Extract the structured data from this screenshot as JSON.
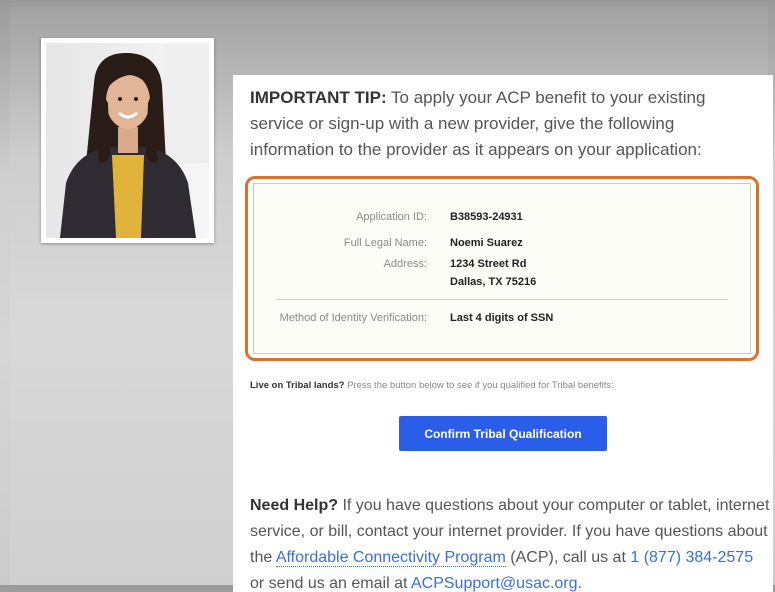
{
  "tip": {
    "heading": "IMPORTANT TIP:",
    "text": " To apply your ACP benefit to your existing service or sign-up with a new provider, give the following information to the provider as it appears on your application:"
  },
  "details": {
    "application_id_label": "Application ID:",
    "application_id_value": "B38593-24931",
    "name_label": "Full Legal Name:",
    "name_value": "Noemi Suarez",
    "address_label": "Address:",
    "address_line1": "1234 Street Rd",
    "address_line2": "Dallas, TX 75216",
    "method_label": "Method of Identity Verification:",
    "method_value": "Last 4 digits of SSN"
  },
  "tribal": {
    "question": "Live on Tribal lands?",
    "text": " Press the button below to see if you qualified for Tribal benefits:",
    "button_label": "Confirm Tribal Qualification"
  },
  "help": {
    "heading": "Need Help?",
    "text1": " If you have questions about your computer or tablet, internet service, or bill, contact your internet provider. If you have questions about the ",
    "program_link": "Affordable Connectivity Program",
    "text2": " (ACP), call us at ",
    "phone_link": "1 (877) 384-2575",
    "text3": " or send us an email at ",
    "email_link": "ACPSupport@usac.org",
    "text4": "."
  },
  "colors": {
    "outline": "#d9722e",
    "button": "#2b5ee8",
    "link": "#3a6fd8"
  }
}
